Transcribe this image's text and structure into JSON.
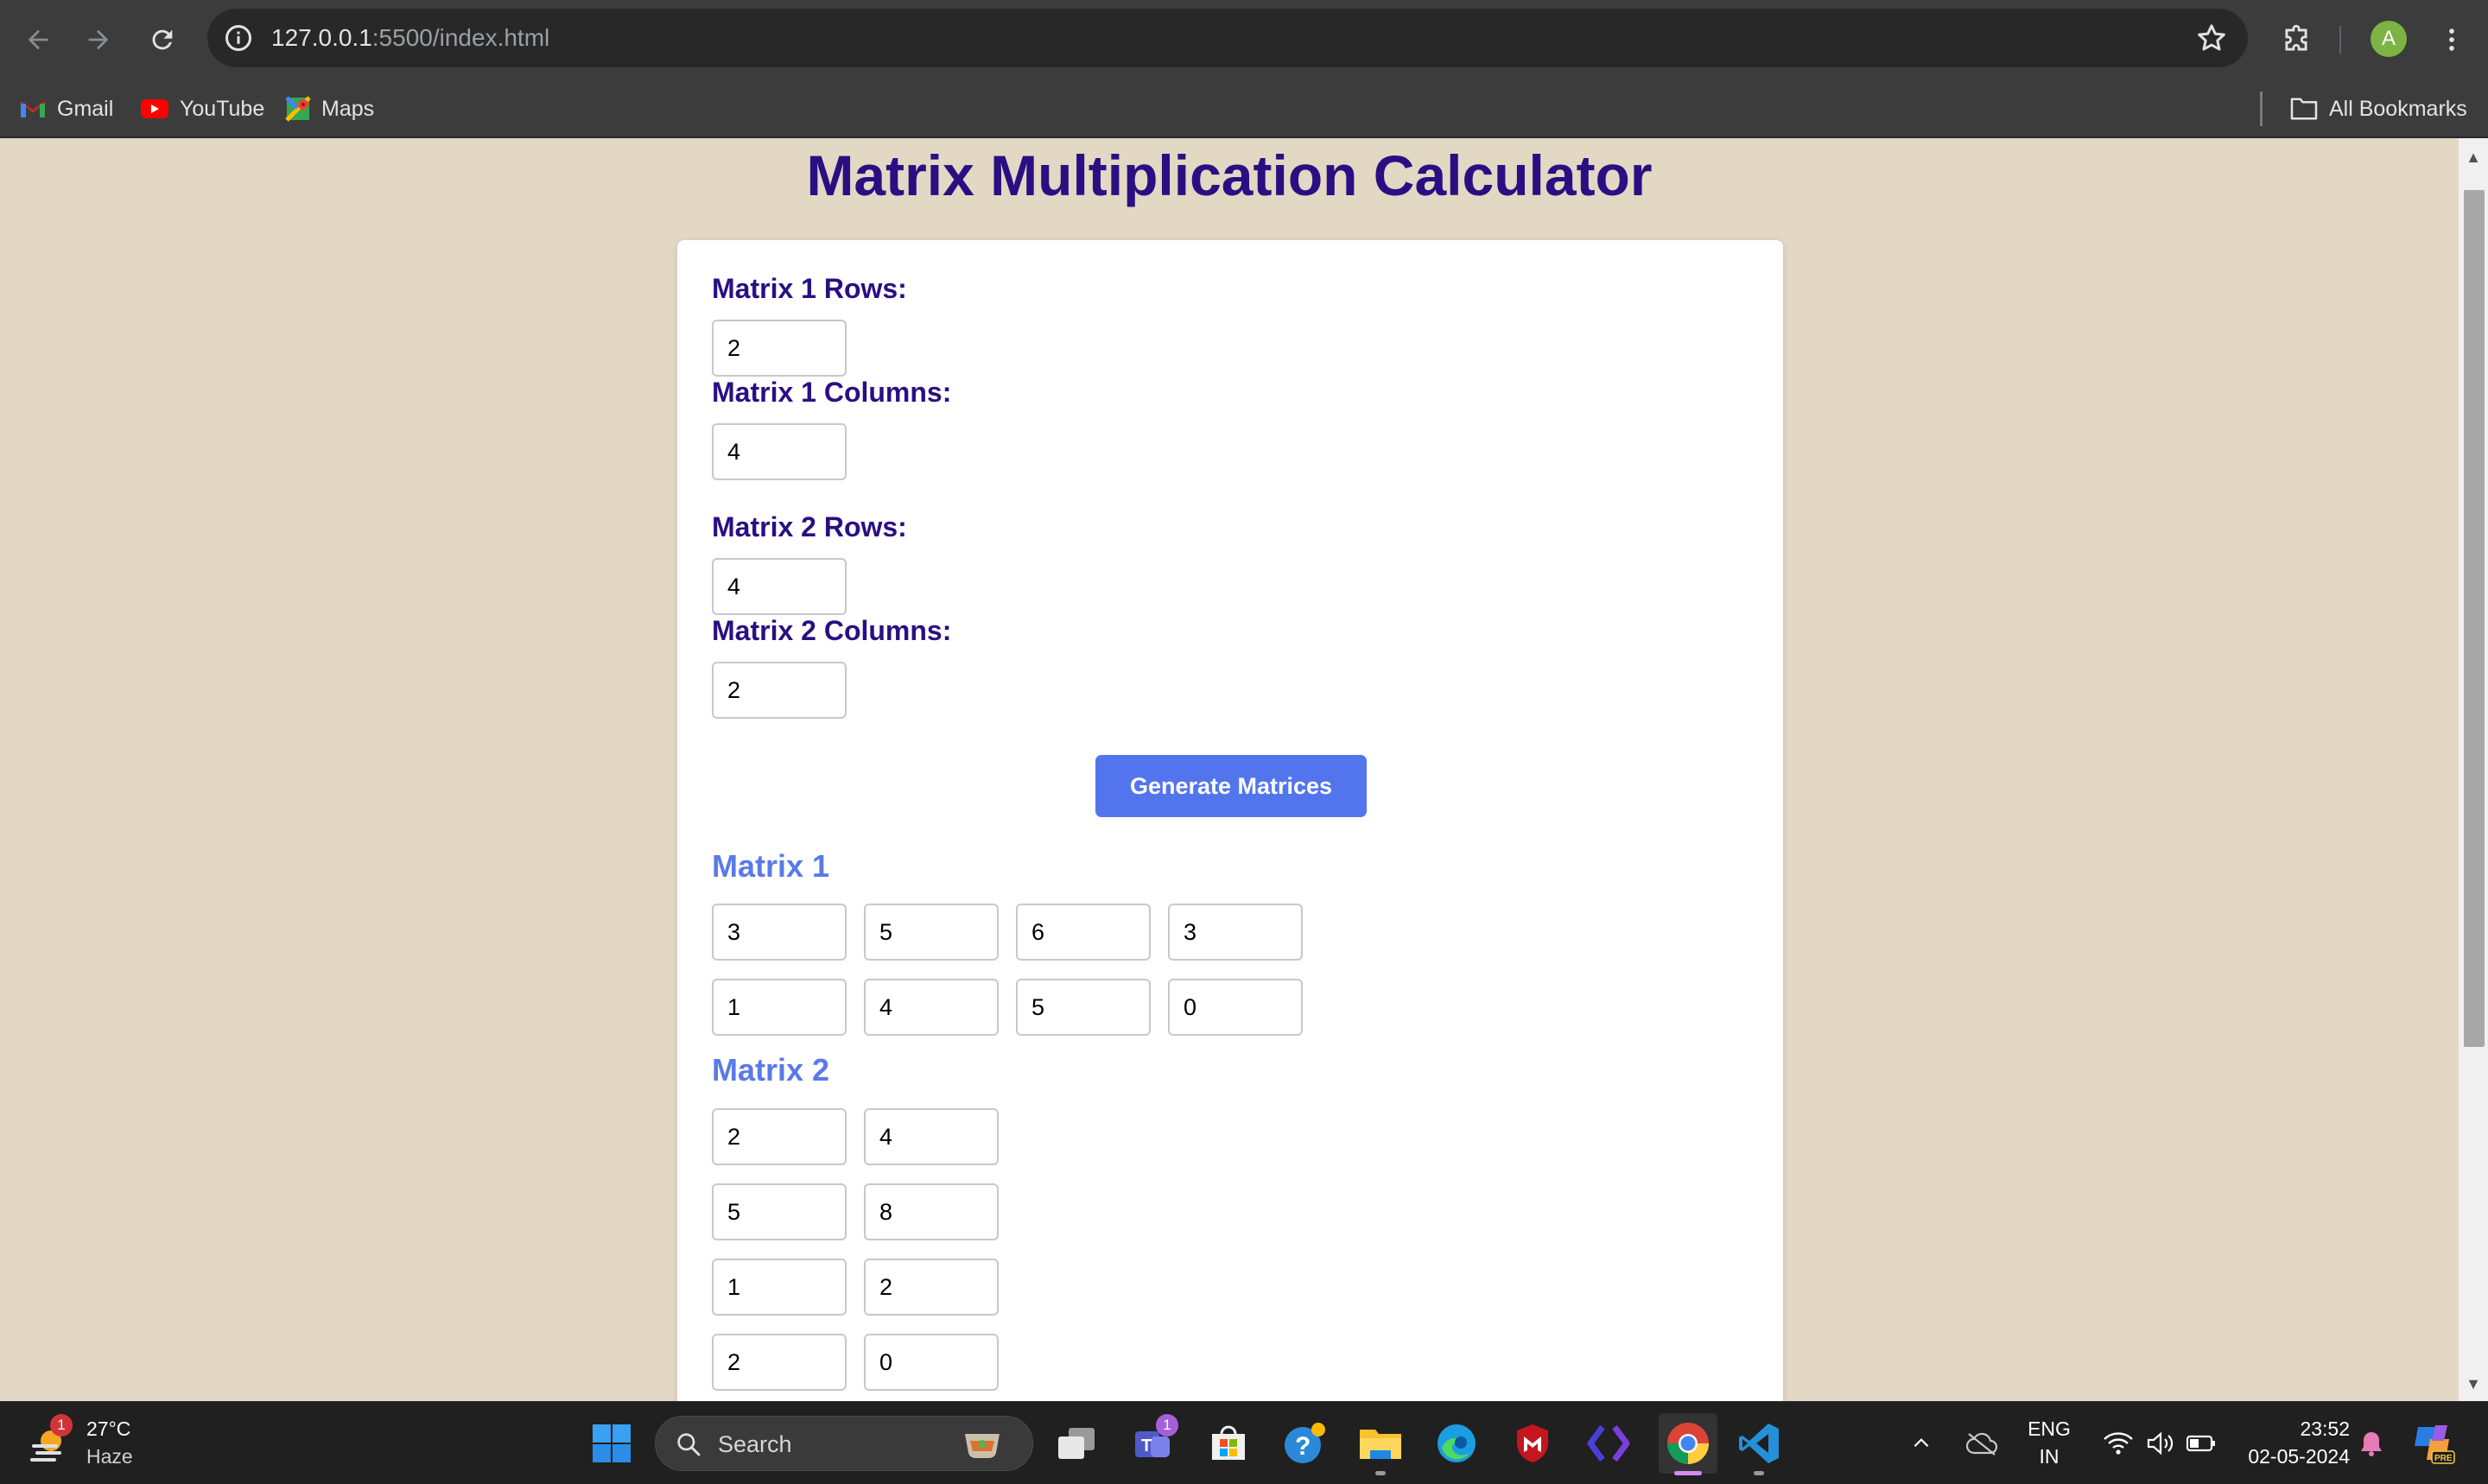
{
  "browser": {
    "url_host": "127.0.0.1",
    "url_path": ":5500/index.html",
    "profile_initial": "A",
    "bookmarks": [
      {
        "label": "Gmail",
        "icon": "gmail-icon"
      },
      {
        "label": "YouTube",
        "icon": "youtube-icon"
      },
      {
        "label": "Maps",
        "icon": "maps-icon"
      }
    ],
    "all_bookmarks_label": "All Bookmarks"
  },
  "page": {
    "title": "Matrix Multiplication Calculator",
    "matrix1_rows_label": "Matrix 1 Rows:",
    "matrix1_rows_value": "2",
    "matrix1_cols_label": "Matrix 1 Columns:",
    "matrix1_cols_value": "4",
    "matrix2_rows_label": "Matrix 2 Rows:",
    "matrix2_rows_value": "4",
    "matrix2_cols_label": "Matrix 2 Columns:",
    "matrix2_cols_value": "2",
    "generate_button": "Generate Matrices",
    "matrix1_title": "Matrix 1",
    "matrix1": [
      [
        "3",
        "5",
        "6",
        "3"
      ],
      [
        "1",
        "4",
        "5",
        "0"
      ]
    ],
    "matrix2_title": "Matrix 2",
    "matrix2": [
      [
        "2",
        "4"
      ],
      [
        "5",
        "8"
      ],
      [
        "1",
        "2"
      ],
      [
        "2",
        "0"
      ]
    ]
  },
  "taskbar": {
    "weather_temp": "27°C",
    "weather_desc": "Haze",
    "weather_badge": "1",
    "search_label": "Search",
    "teams_badge": "1",
    "lang_top": "ENG",
    "lang_bottom": "IN",
    "time": "23:52",
    "date": "02-05-2024"
  },
  "colors": {
    "page_background": "#e2d8c3",
    "title": "#2a0f83",
    "button": "#5275ee",
    "matrix_title": "#5a7ae6"
  }
}
